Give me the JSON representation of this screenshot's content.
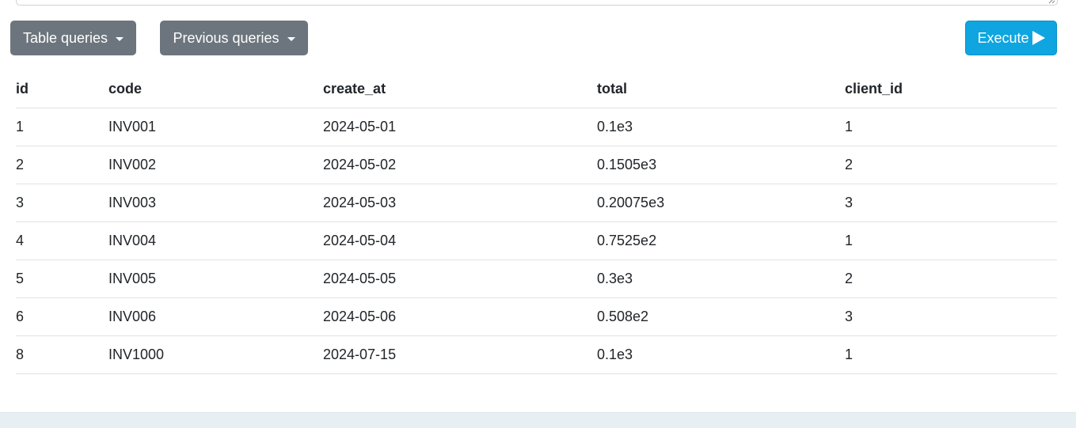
{
  "toolbar": {
    "table_queries_label": "Table queries",
    "previous_queries_label": "Previous queries",
    "execute_label": "Execute"
  },
  "results": {
    "columns": [
      "id",
      "code",
      "create_at",
      "total",
      "client_id"
    ],
    "rows": [
      [
        "1",
        "INV001",
        "2024-05-01",
        "0.1e3",
        "1"
      ],
      [
        "2",
        "INV002",
        "2024-05-02",
        "0.1505e3",
        "2"
      ],
      [
        "3",
        "INV003",
        "2024-05-03",
        "0.20075e3",
        "3"
      ],
      [
        "4",
        "INV004",
        "2024-05-04",
        "0.7525e2",
        "1"
      ],
      [
        "5",
        "INV005",
        "2024-05-05",
        "0.3e3",
        "2"
      ],
      [
        "6",
        "INV006",
        "2024-05-06",
        "0.508e2",
        "3"
      ],
      [
        "8",
        "INV1000",
        "2024-07-15",
        "0.1e3",
        "1"
      ]
    ]
  },
  "colors": {
    "secondary_button": "#6c757d",
    "execute_button": "#0ea5e0"
  },
  "icons": {
    "execute": "play-icon",
    "dropdown": "chevron-down-icon",
    "editor_resize": "resize-handle-icon"
  }
}
